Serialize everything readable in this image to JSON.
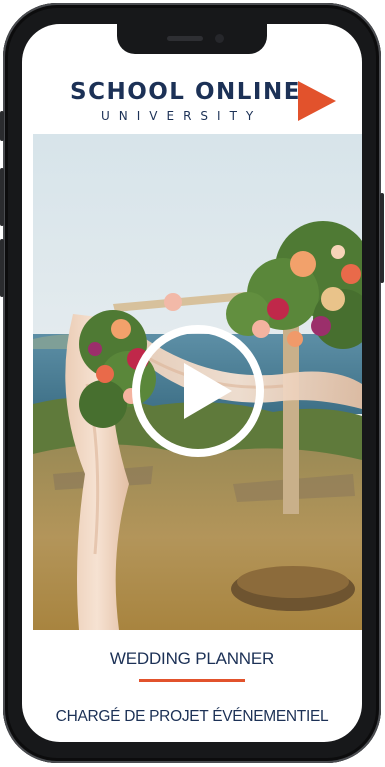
{
  "logo": {
    "line1": "SCHOOL ONLINE",
    "line2": "UNIVERSITY",
    "play_icon": "play-triangle-icon",
    "brand_color": "#e2522c",
    "text_color": "#1c3156"
  },
  "video": {
    "thumbnail": "wedding-floral-arch-photo",
    "play_icon": "play-circle-icon"
  },
  "course": {
    "title": "WEDDING PLANNER",
    "subtitle": "CHARGÉ DE PROJET ÉVÉNEMENTIEL",
    "accent_color": "#e2522c"
  }
}
